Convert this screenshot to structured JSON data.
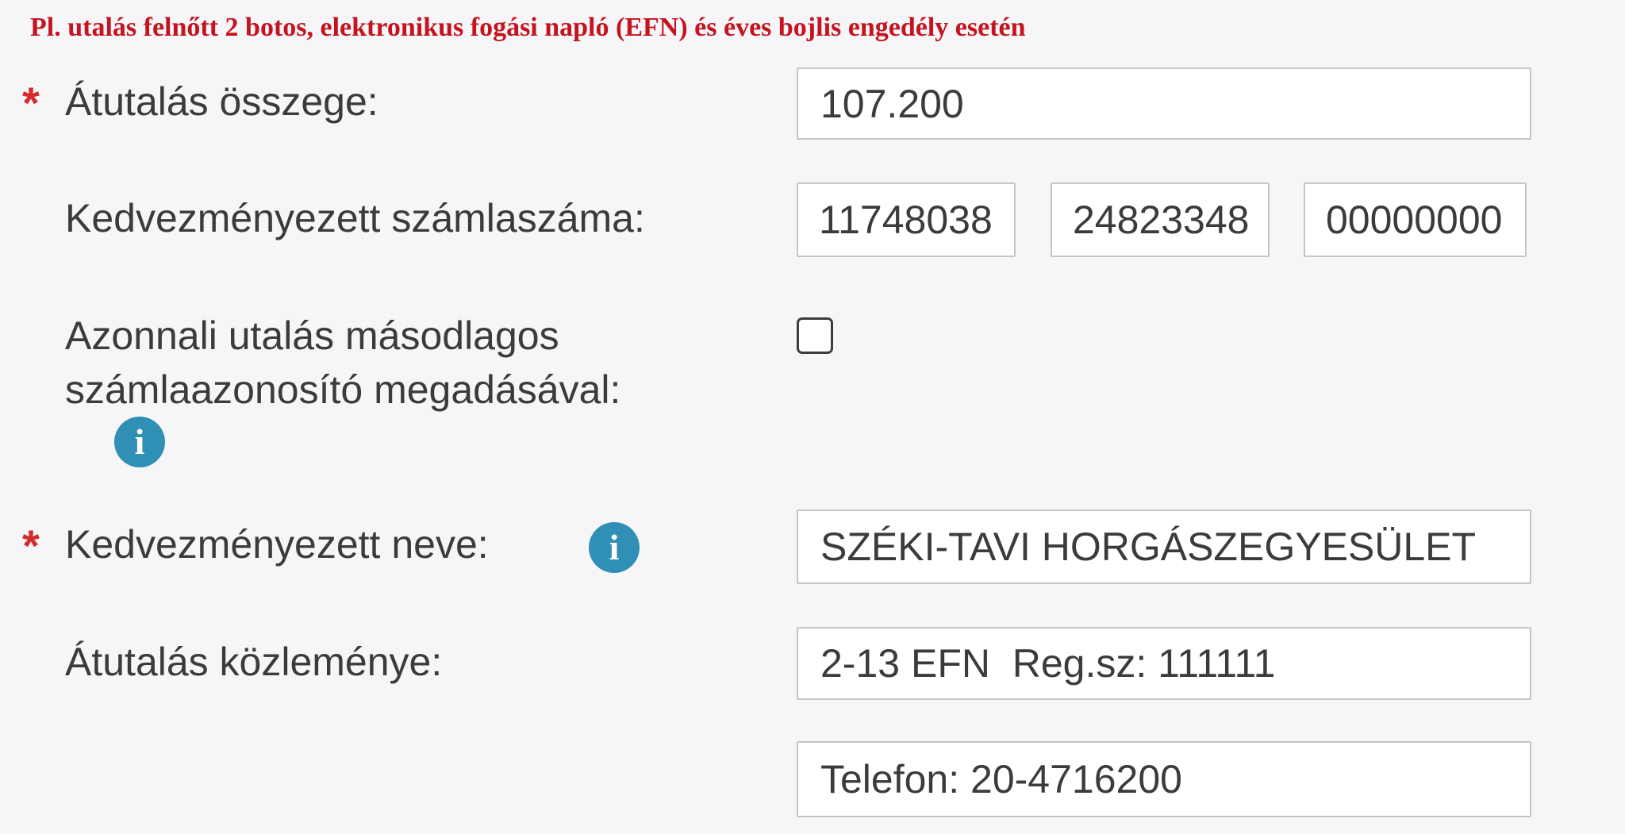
{
  "header": {
    "banner": "Pl. utalás felnőtt 2 botos, elektronikus fogási napló (EFN) és éves bojlis engedély esetén"
  },
  "form": {
    "required_marker": "*",
    "amount": {
      "label": "Átutalás összege:",
      "value": "107.200"
    },
    "account_number": {
      "label": "Kedvezményezett számlaszáma:",
      "part1": "11748038",
      "part2": "24823348",
      "part3": "00000000"
    },
    "instant_transfer": {
      "label_line1": "Azonnali utalás másodlagos",
      "label_line2": "számlaazonosító megadásával:",
      "checked": false
    },
    "beneficiary_name": {
      "label": "Kedvezményezett neve:",
      "value": "SZÉKI-TAVI HORGÁSZEGYESÜLET"
    },
    "remittance": {
      "label": "Átutalás közleménye:",
      "line1": "2-13 EFN  Reg.sz: 111111",
      "line2": "Telefon: 20-4716200"
    },
    "info_icon_glyph": "i"
  },
  "colors": {
    "banner": "#c4141f",
    "required": "#d32b2b",
    "info_icon": "#2f8fb5",
    "background": "#f6f6f8"
  },
  "icons": [
    "info-icon",
    "checkbox-icon"
  ]
}
